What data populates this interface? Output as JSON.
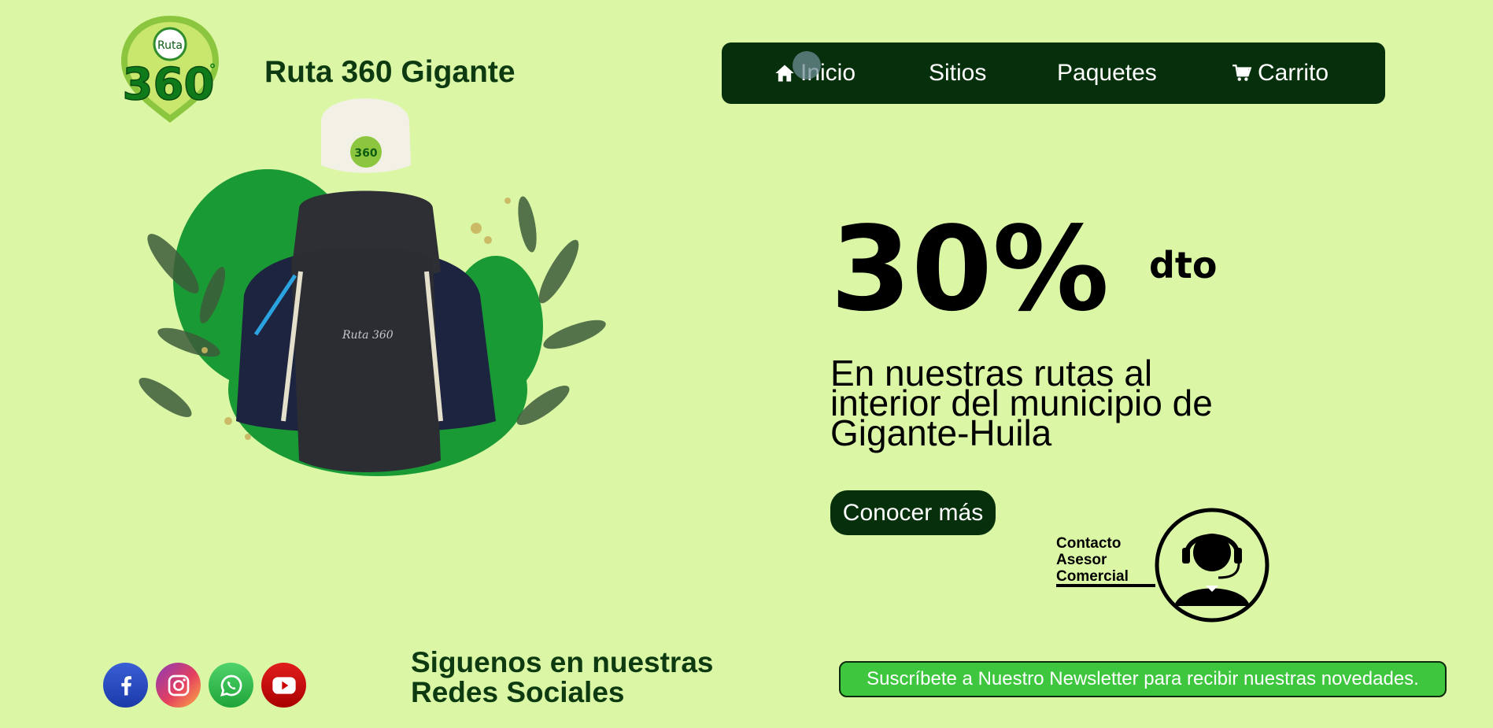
{
  "brand": {
    "logo_text": "Ruta 360°",
    "name": "Ruta 360 Gigante"
  },
  "nav": {
    "items": [
      {
        "label": "Inicio",
        "icon": "home-icon"
      },
      {
        "label": "Sitios"
      },
      {
        "label": "Paquetes"
      },
      {
        "label": "Carrito",
        "icon": "cart-icon"
      }
    ]
  },
  "hero": {
    "image_icon": "hiker-backpack-image"
  },
  "promo": {
    "big": "30%",
    "sup": "dto",
    "text": "En nuestras rutas al interior del municipio de Gigante-Huila",
    "cta": "Conocer más"
  },
  "contact": {
    "lines": [
      "Contacto",
      "Asesor",
      "Comercial"
    ],
    "icon": "support-agent-icon"
  },
  "footer": {
    "social": [
      "facebook-icon",
      "instagram-icon",
      "whatsapp-icon",
      "youtube-icon"
    ],
    "follow_text": "Siguenos en nuestras Redes Sociales",
    "newsletter": "Suscríbete a Nuestro Newsletter para recibir nuestras novedades."
  },
  "colors": {
    "background": "#dbf7a6",
    "nav_bg": "#05300b",
    "brand_green": "#0d3a10",
    "newsletter_green": "#3ec73e"
  }
}
